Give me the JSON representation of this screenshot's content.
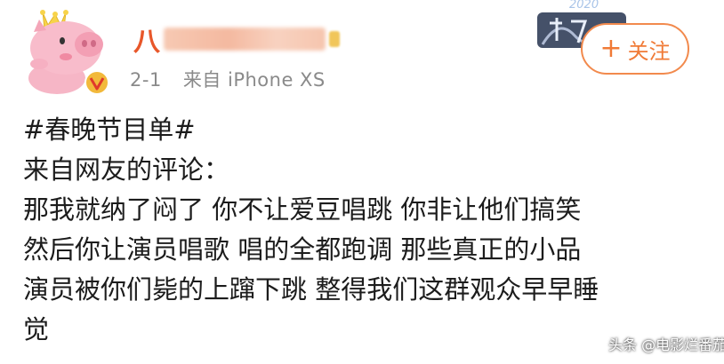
{
  "post": {
    "author": {
      "name_visible_fragment": "八",
      "avatar_icon": "pig-avatar-icon",
      "verified_icon": "verified-v-icon",
      "badge_year": "2020"
    },
    "meta": {
      "date": "2-1",
      "source": "来自 iPhone XS"
    },
    "follow_button": {
      "label": "关注",
      "icon": "plus-icon"
    },
    "content_lines": [
      "#春晚节目单#",
      "来自网友的评论：",
      "那我就纳了闷了 你不让爱豆唱跳 你非让他们搞笑",
      "然后你让演员唱歌 唱的全都跑调 那些真正的小品",
      "演员被你们毙的上蹿下跳 整得我们这群观众早早睡",
      "觉"
    ]
  },
  "watermark": "头条 @电影烂番茄",
  "colors": {
    "accent": "#f07a36",
    "meta_text": "#8a8a8a",
    "verified": "#e6a23c"
  }
}
